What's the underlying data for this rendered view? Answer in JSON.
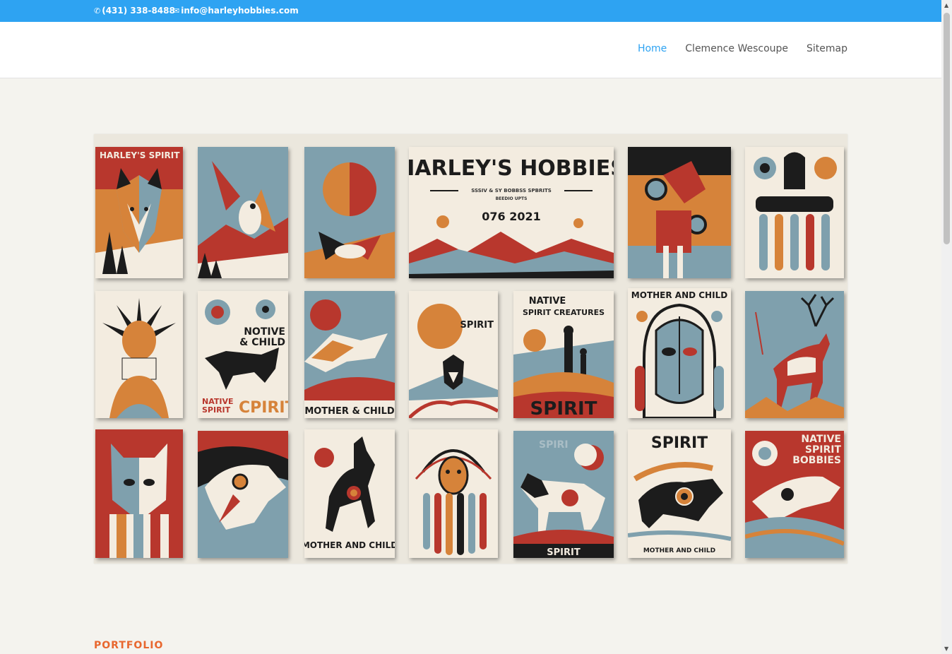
{
  "topbar": {
    "phone": "(431) 338-8488",
    "email": "info@harleyhobbies.com",
    "phone_icon": "phone-icon",
    "email_icon": "envelope-icon"
  },
  "nav": {
    "items": [
      {
        "label": "Home",
        "active": true
      },
      {
        "label": "Clemence Wescoupe",
        "active": false
      },
      {
        "label": "Sitemap",
        "active": false
      }
    ]
  },
  "hero": {
    "title": "HARLEY'S HOBBIES",
    "subtitle_line1": "SSSIV & SY BOBBSS SPBRITS",
    "subtitle_line2": "BEEDIO UPTS",
    "year": "076 2021",
    "card_labels": {
      "c1": "HARLEY'S SPIRIT",
      "c9_line1": "NOTIVE",
      "c9_line2": "& CHILD",
      "c9_line3": "NATIVE",
      "c9_line4": "SPIRIT",
      "c9_big": "CPIRIT",
      "c10": "MOTHER & CHILD",
      "c11": "SPIRIT",
      "c12_line1": "NATIVE",
      "c12_line2": "SPIRIT CREATURES",
      "c12_big": "SPIRIT",
      "c13": "MOTHER AND CHILD",
      "c17": "MOTHER AND CHILD",
      "c19_top": "SPIRI",
      "c19_bottom": "SPIRIT",
      "c20_top": "SPIRIT",
      "c20_bottom": "MOTHER AND CHILD",
      "c21_line1": "NATIVE",
      "c21_line2": "SPIRIT",
      "c21_line3": "BOBBIES"
    }
  },
  "portfolio": {
    "label": "PORTFOLIO"
  },
  "colors": {
    "topbar": "#2ea3f2",
    "nav_active": "#2ea3f2",
    "portfolio_accent": "#e8672e",
    "palette_red": "#b8372d",
    "palette_orange": "#d6833a",
    "palette_blue": "#7fa0ad",
    "palette_cream": "#f3ece0"
  }
}
